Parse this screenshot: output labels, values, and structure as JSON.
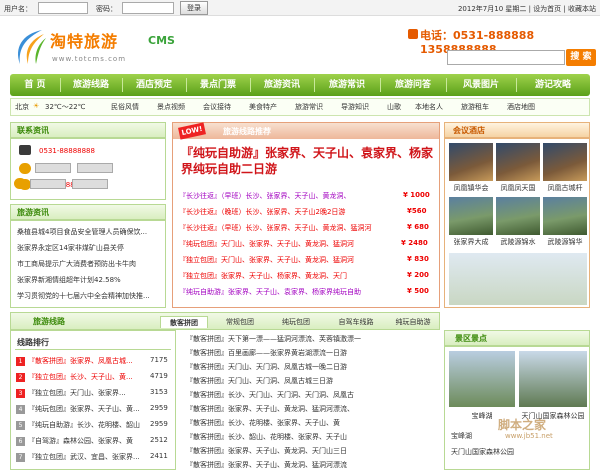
{
  "topbar": {
    "username_label": "用户名：",
    "password_label": "密码：",
    "login": "登录",
    "date": "2012年7月10 星期二",
    "set_home": "设为首页",
    "favorite": "收藏本站"
  },
  "logo": {
    "main": "淘特旅游",
    "cms": "CMS",
    "url": "www.totcms.com"
  },
  "phone": "电话：0531-888888  1358888888",
  "search": {
    "button": "搜 索"
  },
  "nav": [
    "首 页",
    "旅游线路",
    "酒店预定",
    "景点门票",
    "旅游资讯",
    "旅游常识",
    "旅游问答",
    "风景图片",
    "游记攻略"
  ],
  "subbar": {
    "city": "北京",
    "temp": "32℃～22℃",
    "items": [
      "民俗风情",
      "景点视频",
      "会议接待",
      "美食特产",
      "旅游常识",
      "导游知识",
      "山歌",
      "本地名人",
      "旅游租车",
      "酒店地图"
    ]
  },
  "contact": {
    "title": "联系资讯",
    "phone": "0531-88888888",
    "mobile": "13888888888"
  },
  "news": {
    "title": "旅游资讯",
    "items": [
      "桑植县城4项目食品安全管理人员确保饮...",
      "张家界永定区14家非煤矿山县关停",
      "市工商局提示广大消费者预防出卡牛肉",
      "张家界新湘情组超年计划42.58%",
      "学习贯彻党的十七届六中全会精神加快推..."
    ]
  },
  "featured": {
    "badge": "LOW!",
    "title": "旅游线路推荐",
    "headline": "『纯玩自助游』张家界、天子山、袁家界、杨家界纯玩自助二日游",
    "lines": [
      {
        "t": "『长沙往返』（早班）长沙、张家界、天子山、黄龙洞、",
        "p": "¥ 1000",
        "c": "pur"
      },
      {
        "t": "『长沙往返』（晚班）长沙、张家界、天子山2晚2日游",
        "p": "¥560",
        "c": "red"
      },
      {
        "t": "『长沙往返』（早班）长沙、张家界、天子山、黄龙洞、猛洞河",
        "p": "¥ 680",
        "c": "red"
      },
      {
        "t": "『纯玩包团』天门山、张家界、天子山、黄龙洞、猛洞河",
        "p": "¥ 2480",
        "c": "red"
      },
      {
        "t": "『独立包团』天门山、张家界、天子山、黄龙洞、猛洞河",
        "p": "¥ 830",
        "c": "red"
      },
      {
        "t": "『独立包团』张家界、天子山、杨家界、黄龙洞、天门",
        "p": "¥ 200",
        "c": "red"
      },
      {
        "t": "『纯玩自助游』张家界、天子山、袁家界、杨家界纯玩自助",
        "p": "¥ 500",
        "c": "pur"
      }
    ]
  },
  "hotel": {
    "title": "会议酒店",
    "items": [
      "凤凰镇华会",
      "凤凰凤天国",
      "凤凰古城杆",
      "张家界大成",
      "武陵源锦水",
      "武陵源锦华"
    ]
  },
  "lines_panel": {
    "title": "旅游线路",
    "tabs": [
      "散客拼团",
      "常规包团",
      "纯玩包团",
      "自驾车线路",
      "纯玩自助游"
    ]
  },
  "rank": {
    "title": "线路排行",
    "items": [
      {
        "t": "『散客拼团』张家界、凤凰古城...",
        "n": "7175"
      },
      {
        "t": "『独立包团』长沙、天子山、黄...",
        "n": "4719"
      },
      {
        "t": "『独立包团』天门山、张家界...",
        "n": "3153"
      },
      {
        "t": "『纯玩包团』张家界、天子山、黄...",
        "n": "2959"
      },
      {
        "t": "『纯玩自助游』长沙、花明楼、韶山",
        "n": "2959"
      },
      {
        "t": "『自驾游』森林公园、张家界、黄",
        "n": "2512"
      },
      {
        "t": "『独立包团』武汉、宜昌、张家界...",
        "n": "2411"
      }
    ]
  },
  "mid_list": {
    "items": [
      "『散客拼团』天下第一漂——猛洞河漂流、芙蓉镇激漂一",
      "『散客拼团』百里画廊——张家界黄岩湖漂流一日游",
      "『散客拼团』天门山、天门洞、凤凰古城一晚二日游",
      "『散客拼团』天门山、天门洞、凤凰古城三日游",
      "『散客拼团』长沙、天门山、天门洞、天门洞、凤凰古",
      "『散客拼团』张家界、天子山、黄龙洞、猛洞河漂流、",
      "『散客拼团』长沙、花明楼、张家界、天子山、黄",
      "『散客拼团』长沙、韶山、花明楼、张家界、天子山",
      "『散客拼团』张家界、天子山、黄龙洞、天门山三日",
      "『散客拼团』张家界、天子山、黄龙洞、猛洞河漂流",
      "『散客拼团』天门山、张家界、天子山、黄龙洞、凤"
    ]
  },
  "scenic": {
    "title": "景区景点",
    "items": [
      "宝峰湖",
      "天门山国家森林公园"
    ],
    "list": [
      "宝峰湖",
      "天门山国家森林公园"
    ]
  },
  "watermark": {
    "main": "脚本之家",
    "url": "www.jb51.net"
  }
}
